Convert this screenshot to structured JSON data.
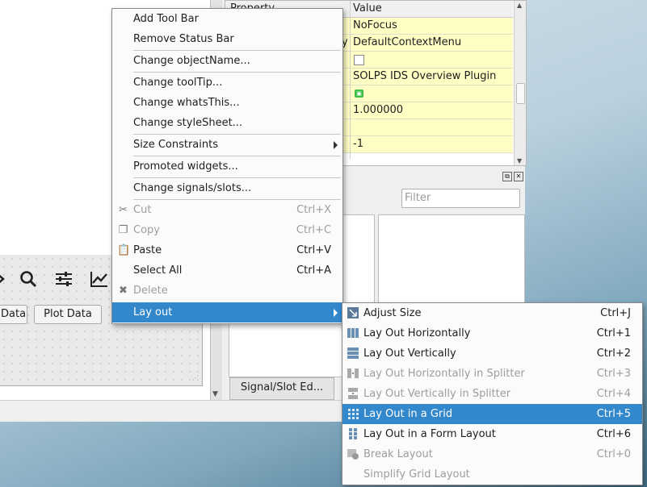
{
  "form": {
    "plot_button_left": "Data",
    "plot_button": "Plot Data"
  },
  "property_editor": {
    "header_property": "Property",
    "header_value": "Value",
    "rows": [
      {
        "key": "",
        "value": "NoFocus"
      },
      {
        "key": "y",
        "value": "DefaultContextMenu"
      },
      {
        "key": "",
        "value": ""
      },
      {
        "key": "",
        "value": "SOLPS IDS Overview Plugin"
      },
      {
        "key": "",
        "value": ""
      },
      {
        "key": "",
        "value": "1.000000"
      },
      {
        "key": "",
        "value": ""
      },
      {
        "key": "",
        "value": "-1"
      }
    ]
  },
  "signal_slot": {
    "filter_placeholder": "Filter",
    "tab_label": "Signal/Slot Ed..."
  },
  "context_menu": {
    "items": [
      {
        "label": "Add Tool Bar"
      },
      {
        "label": "Remove Status Bar"
      },
      {
        "label": "Change objectName..."
      },
      {
        "label": "Change toolTip..."
      },
      {
        "label": "Change whatsThis..."
      },
      {
        "label": "Change styleSheet..."
      },
      {
        "label": "Size Constraints"
      },
      {
        "label": "Promoted widgets..."
      },
      {
        "label": "Change signals/slots..."
      },
      {
        "label": "Cut",
        "shortcut": "Ctrl+X",
        "icon": "scissors-icon"
      },
      {
        "label": "Copy",
        "shortcut": "Ctrl+C",
        "icon": "copy-icon"
      },
      {
        "label": "Paste",
        "shortcut": "Ctrl+V",
        "icon": "paste-icon"
      },
      {
        "label": "Select All",
        "shortcut": "Ctrl+A"
      },
      {
        "label": "Delete",
        "icon": "delete-x-icon"
      },
      {
        "label": "Lay out"
      }
    ]
  },
  "layout_submenu": {
    "items": [
      {
        "label": "Adjust Size",
        "shortcut": "Ctrl+J",
        "icon": "adjust-size-icon"
      },
      {
        "label": "Lay Out Horizontally",
        "shortcut": "Ctrl+1",
        "icon": "horizontal-layout-icon"
      },
      {
        "label": "Lay Out Vertically",
        "shortcut": "Ctrl+2",
        "icon": "vertical-layout-icon"
      },
      {
        "label": "Lay Out Horizontally in Splitter",
        "shortcut": "Ctrl+3",
        "icon": "horizontal-splitter-icon"
      },
      {
        "label": "Lay Out Vertically in Splitter",
        "shortcut": "Ctrl+4",
        "icon": "vertical-splitter-icon"
      },
      {
        "label": "Lay Out in a Grid",
        "shortcut": "Ctrl+5",
        "icon": "grid-layout-icon"
      },
      {
        "label": "Lay Out in a Form Layout",
        "shortcut": "Ctrl+6",
        "icon": "form-layout-icon"
      },
      {
        "label": "Break Layout",
        "shortcut": "Ctrl+0",
        "icon": "break-layout-icon"
      },
      {
        "label": "Simplify Grid Layout"
      }
    ]
  },
  "colors": {
    "selection": "#3388cc",
    "property_row_bg": "#fffec4"
  }
}
